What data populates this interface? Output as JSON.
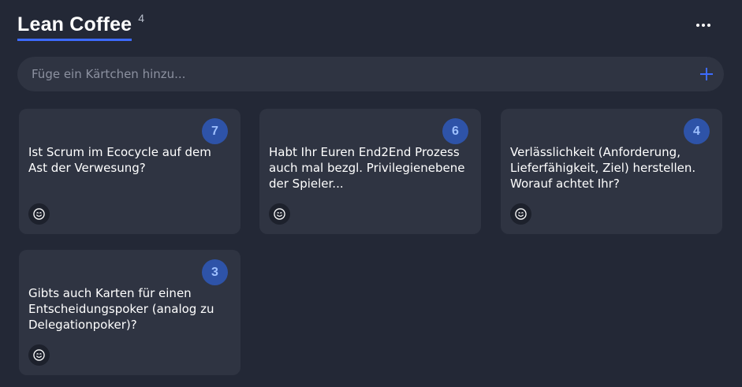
{
  "board": {
    "title": "Lean Coffee",
    "count": "4",
    "menu_icon": "more-horizontal-icon"
  },
  "add_card": {
    "placeholder": "Füge ein Kärtchen hinzu...",
    "value": "",
    "icon": "plus-icon"
  },
  "colors": {
    "background": "#232836",
    "card": "#2f3442",
    "accent": "#3d6bff",
    "vote_badge": "#2e53a8"
  },
  "cards": [
    {
      "votes": "7",
      "text": "Ist Scrum im Ecocycle auf dem Ast der Verwesung?",
      "reaction_icon": "smiley-icon"
    },
    {
      "votes": "6",
      "text": "Habt Ihr Euren End2End Prozess auch mal bezgl. Privilegienebene der Spieler...",
      "reaction_icon": "smiley-icon"
    },
    {
      "votes": "4",
      "text": "Verlässlichkeit (Anforderung, Lieferfähigkeit, Ziel) herstellen. Worauf achtet Ihr?",
      "reaction_icon": "smiley-icon"
    },
    {
      "votes": "3",
      "text": "Gibts auch Karten für einen Entscheidungspoker (analog zu Delegationpoker)?",
      "reaction_icon": "smiley-icon"
    }
  ]
}
